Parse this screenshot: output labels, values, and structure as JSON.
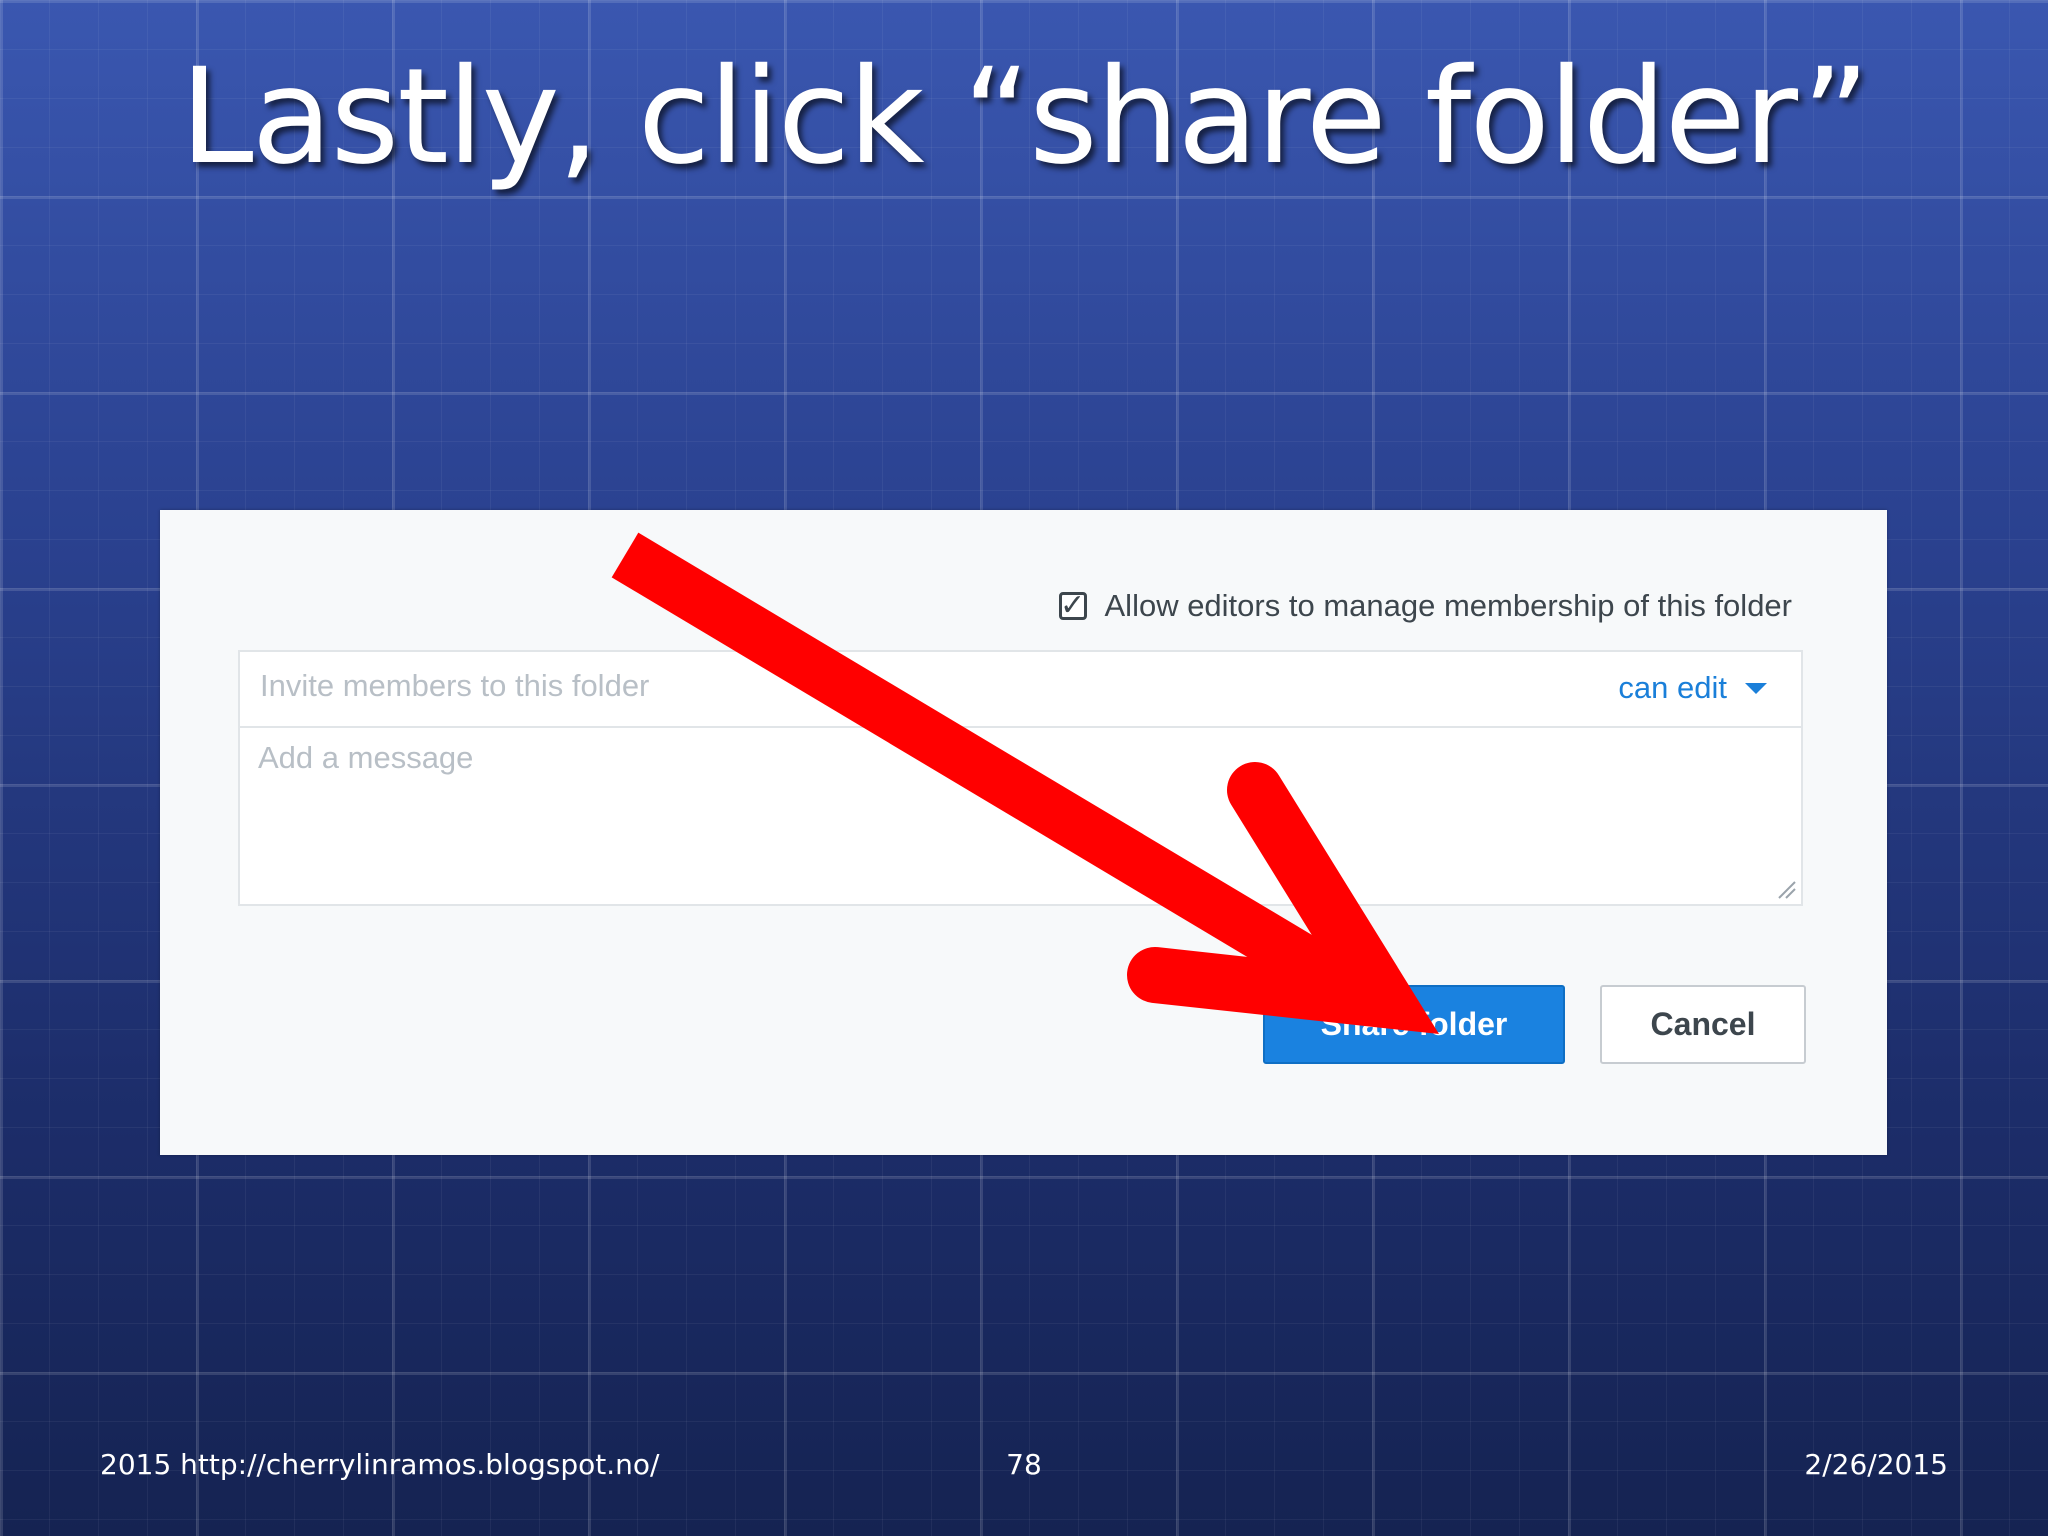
{
  "slide": {
    "title": "Lastly, click “share folder”"
  },
  "dialog": {
    "checkbox_label": "Allow editors to manage membership of this folder",
    "checkbox_checked": true,
    "invite_placeholder": "Invite members to this folder",
    "permission_label": "can edit",
    "message_placeholder": "Add a message",
    "share_button": "Share folder",
    "cancel_button": "Cancel"
  },
  "annotation": {
    "arrow_color": "#ff0000"
  },
  "footer": {
    "left": "2015 http://cherrylinramos.blogspot.no/",
    "page_number": "78",
    "date": "2/26/2015"
  },
  "colors": {
    "primary_button": "#1a82e0",
    "link": "#1a7fd9",
    "placeholder": "#b8bfc6"
  }
}
